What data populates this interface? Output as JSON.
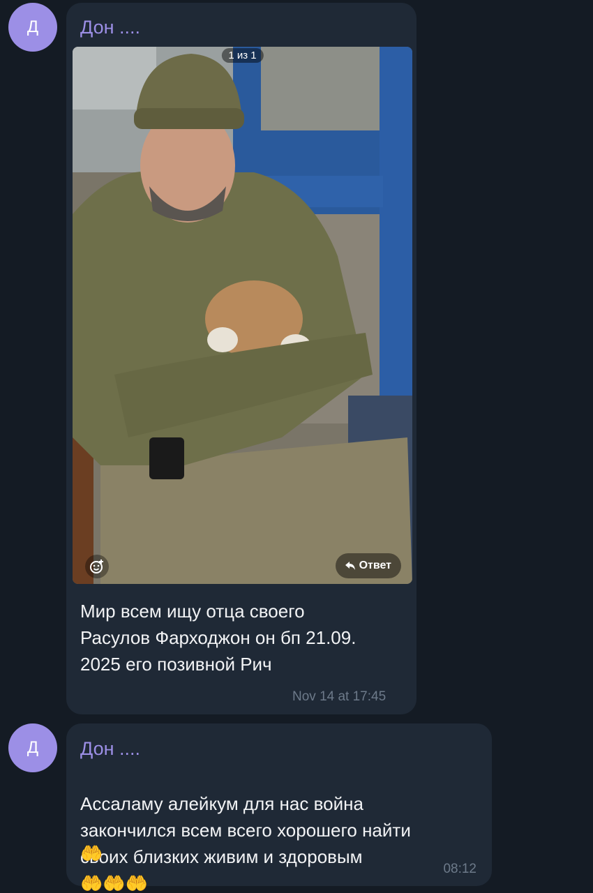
{
  "messages": [
    {
      "avatar_letter": "Д",
      "sender": "Дон ....",
      "photo": {
        "counter": "1 из 1",
        "reply_label": "Ответ",
        "react_icon": "smile-add-icon",
        "reply_icon": "reply-arrow-icon"
      },
      "text": "Мир всем ищу отца своего\nРасулов Фарходжон он бп 21.09.\n2025 его позивной Рич",
      "time": "Nov 14 at 17:45"
    },
    {
      "avatar_letter": "Д",
      "sender": "Дон ....",
      "text": "Ассаламу алейкум для нас война\nзакончился всем всего хорошего найти\nсвоих близких живим и здоровым",
      "emoji_inline": "🤲🤲🤲",
      "emoji_next": "🤲",
      "time": "08:12"
    }
  ],
  "colors": {
    "background": "#141b24",
    "bubble": "#1f2936",
    "sender_name": "#9c8fe6",
    "avatar": "#9c8fe6",
    "time": "#6d7a8a"
  }
}
